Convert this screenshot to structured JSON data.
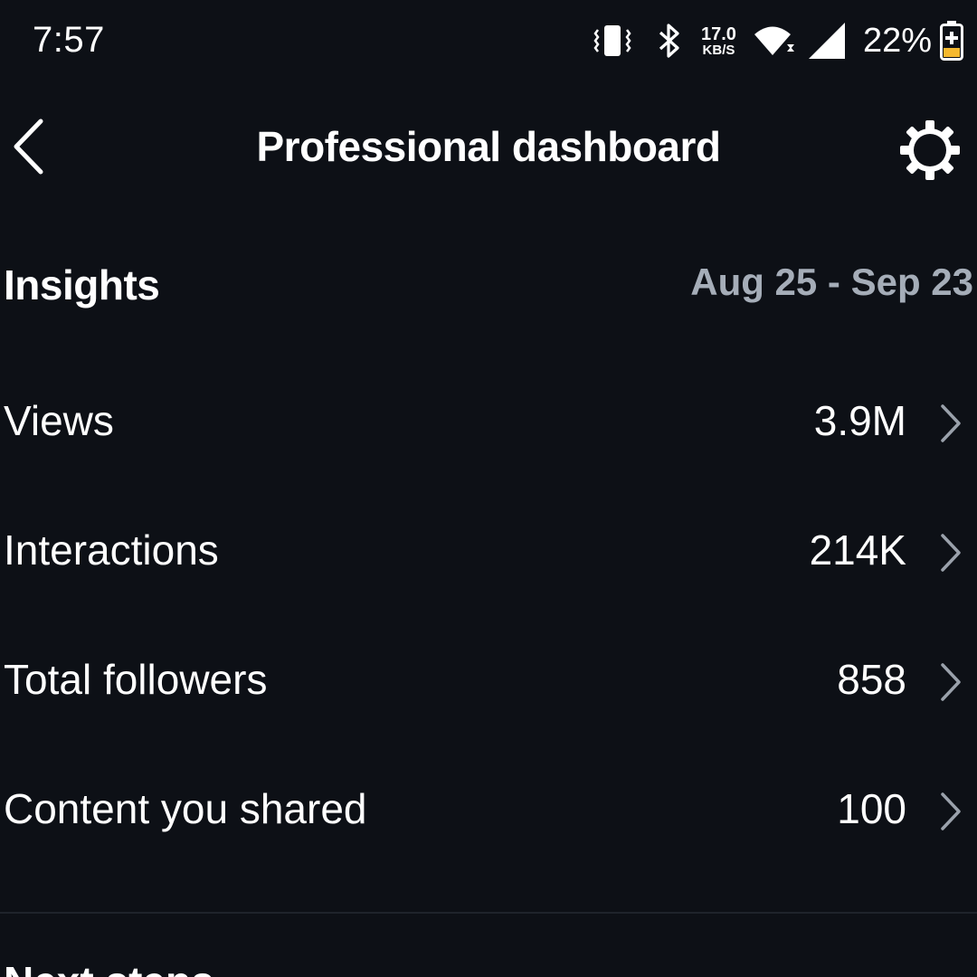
{
  "status_bar": {
    "time": "7:57",
    "net_speed_value": "17.0",
    "net_speed_unit": "KB/S",
    "battery_percent": "22%",
    "icons": [
      "vibrate-icon",
      "bluetooth-icon",
      "wifi-icon",
      "signal-icon",
      "battery-charging-icon"
    ],
    "battery_accent_color": "#f5b82e"
  },
  "header": {
    "title": "Professional dashboard",
    "back_icon": "chevron-left-icon",
    "settings_icon": "gear-icon"
  },
  "insights": {
    "title": "Insights",
    "date_range": "Aug 25 - Sep 23",
    "date_range_color": "#a5adb8",
    "metrics": [
      {
        "label": "Views",
        "value": "3.9M"
      },
      {
        "label": "Interactions",
        "value": "214K"
      },
      {
        "label": "Total followers",
        "value": "858"
      },
      {
        "label": "Content you shared",
        "value": "100"
      }
    ]
  },
  "next_section": {
    "title": "Next steps"
  },
  "colors": {
    "background": "#0d1016",
    "text": "#ffffff",
    "chevron": "#9aa1ab",
    "divider": "#1f232b"
  }
}
